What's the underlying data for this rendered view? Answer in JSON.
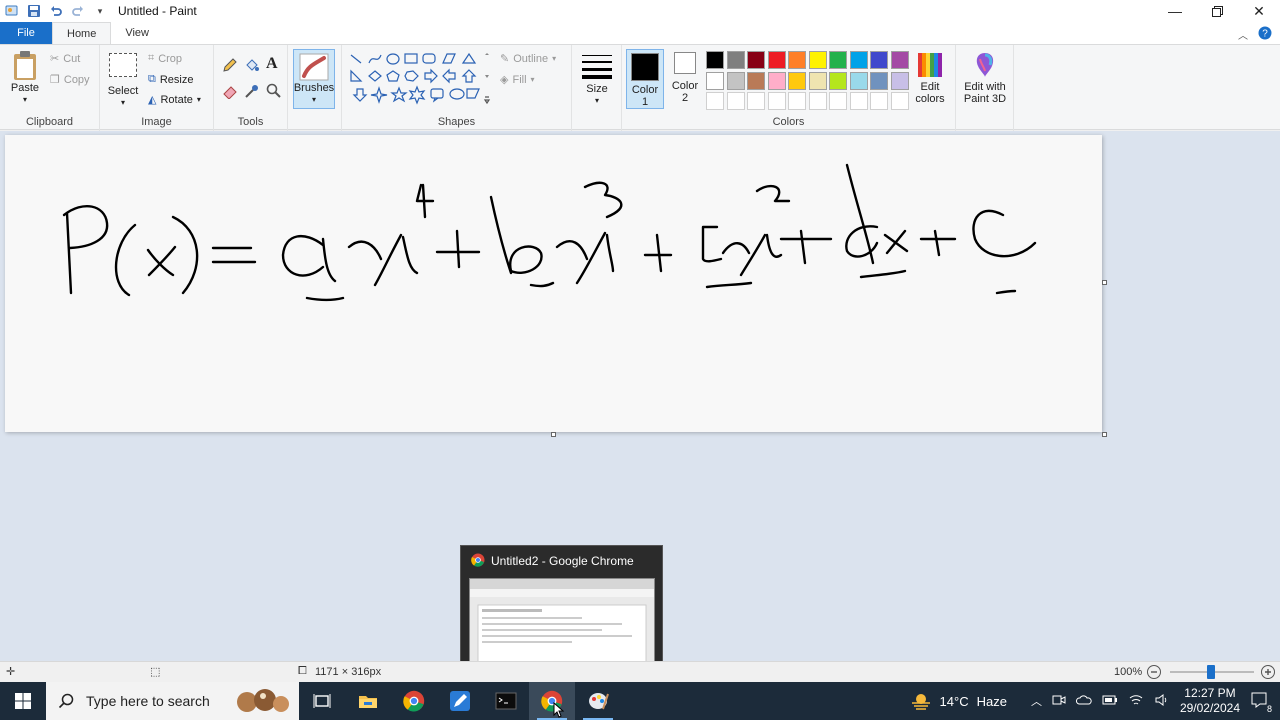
{
  "window": {
    "title": "Untitled - Paint"
  },
  "tabs": {
    "file": "File",
    "home": "Home",
    "view": "View"
  },
  "clipboard": {
    "paste": "Paste",
    "cut": "Cut",
    "copy": "Copy",
    "label": "Clipboard"
  },
  "image": {
    "select": "Select",
    "crop": "Crop",
    "resize": "Resize",
    "rotate": "Rotate",
    "label": "Image"
  },
  "tools": {
    "label": "Tools"
  },
  "brushes": {
    "label": "Brushes"
  },
  "shapes": {
    "outline": "Outline",
    "fill": "Fill",
    "label": "Shapes"
  },
  "size": {
    "label": "Size"
  },
  "colors": {
    "color1": "Color",
    "color1_num": "1",
    "color2": "Color",
    "color2_num": "2",
    "edit": "Edit",
    "edit2": "colors",
    "paint3d": "Edit with",
    "paint3d2": "Paint 3D",
    "label": "Colors",
    "palette_row1": [
      "#000000",
      "#7f7f7f",
      "#880015",
      "#ed1c24",
      "#ff7f27",
      "#fff200",
      "#22b14c",
      "#00a2e8",
      "#3f48cc",
      "#a349a4"
    ],
    "palette_row2": [
      "#ffffff",
      "#c3c3c3",
      "#b97a57",
      "#ffaec9",
      "#ffc90e",
      "#efe4b0",
      "#b5e61d",
      "#99d9ea",
      "#7092be",
      "#c8bfe7"
    ]
  },
  "status": {
    "dimensions": "1171 × 316px",
    "zoom": "100%"
  },
  "preview": {
    "title": "Untitled2 - Google Chrome"
  },
  "taskbar": {
    "search_placeholder": "Type here to search",
    "weather_temp": "14°C",
    "weather_desc": "Haze",
    "time": "12:27 PM",
    "date": "29/02/2024",
    "notification_count": "8"
  }
}
